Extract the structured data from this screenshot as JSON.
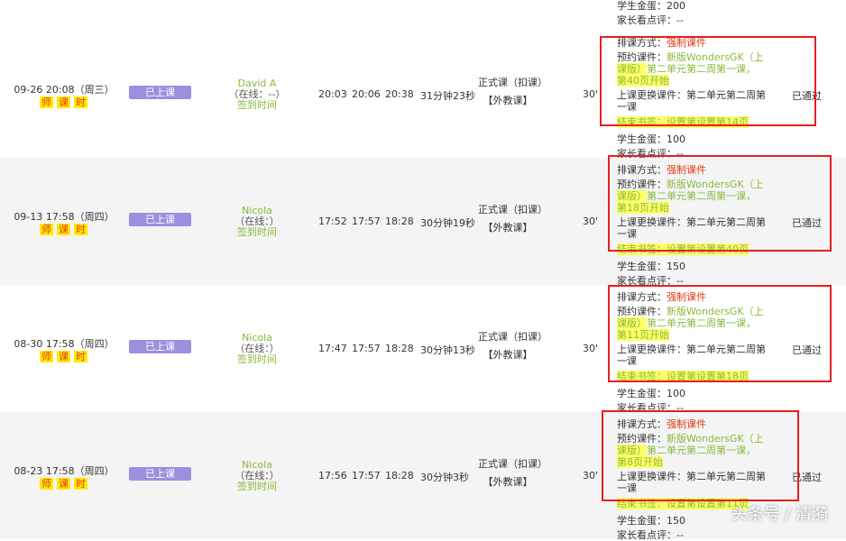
{
  "top": {
    "gold_label": "学生金蛋：",
    "gold_value": "200",
    "review_label": "家长看点评：",
    "review_value": "--"
  },
  "labels": {
    "scheduling": "排课方式：",
    "forced": "强制课件",
    "booked": "预约课件：",
    "course_line1": "新版WondersGK（上",
    "course_line2_prefix": "课版）",
    "course_line2_rest": "第二单元第二周第一课，",
    "switch_line1": "上课更换课件：第二单元第二周第",
    "switch_line2": "一课",
    "end_bookmark": "结束书签：设置第",
    "gold": "学生金蛋：",
    "review": "家长看点评：",
    "review_value": "--",
    "pass": "已通过",
    "class_type_1": "正式课（扣课）",
    "class_type_2": "【外教课】",
    "minutes": "30'",
    "status": "已上课",
    "online": "（在线：--）",
    "sign_time": "签到时间"
  },
  "tags": [
    "师",
    "课",
    "时"
  ],
  "rows": [
    {
      "date": "09-26 20:08（周三）",
      "teacher": "David A",
      "online": "（在线：--）",
      "t1": "20:03",
      "t2": "20:06",
      "t3": "20:38",
      "duration": "31分钟23秒",
      "start_page": "第40页开始",
      "end_page": "设置第14页",
      "gold": "100"
    },
    {
      "date": "09-13 17:58（周四）",
      "teacher": "Nicola",
      "online": "（在线：）",
      "t1": "17:52",
      "t2": "17:57",
      "t3": "18:28",
      "duration": "30分钟19秒",
      "start_page": "第18页开始",
      "end_page": "设置第40页",
      "gold": "150"
    },
    {
      "date": "08-30 17:58（周四）",
      "teacher": "Nicola",
      "online": "（在线：）",
      "t1": "17:47",
      "t2": "17:57",
      "t3": "18:28",
      "duration": "30分钟13秒",
      "start_page": "第11页开始",
      "end_page": "设置第18页",
      "gold": "100"
    },
    {
      "date": "08-23 17:58（周四）",
      "teacher": "Nicola",
      "online": "（在线：）",
      "t1": "17:56",
      "t2": "17:57",
      "t3": "18:28",
      "duration": "30分钟3秒",
      "start_page": "第8页开始",
      "end_page": "设置第11页",
      "gold": "150"
    }
  ],
  "watermark": "头条号 / 清漪",
  "colors": {
    "status_purple": "#9b8fe0",
    "forced_red": "#e03a1a",
    "course_green": "#8bb83b",
    "highlight_yellow": "#ffff66",
    "annotation_red": "#e52020",
    "tag_yellow": "#ffe900"
  }
}
